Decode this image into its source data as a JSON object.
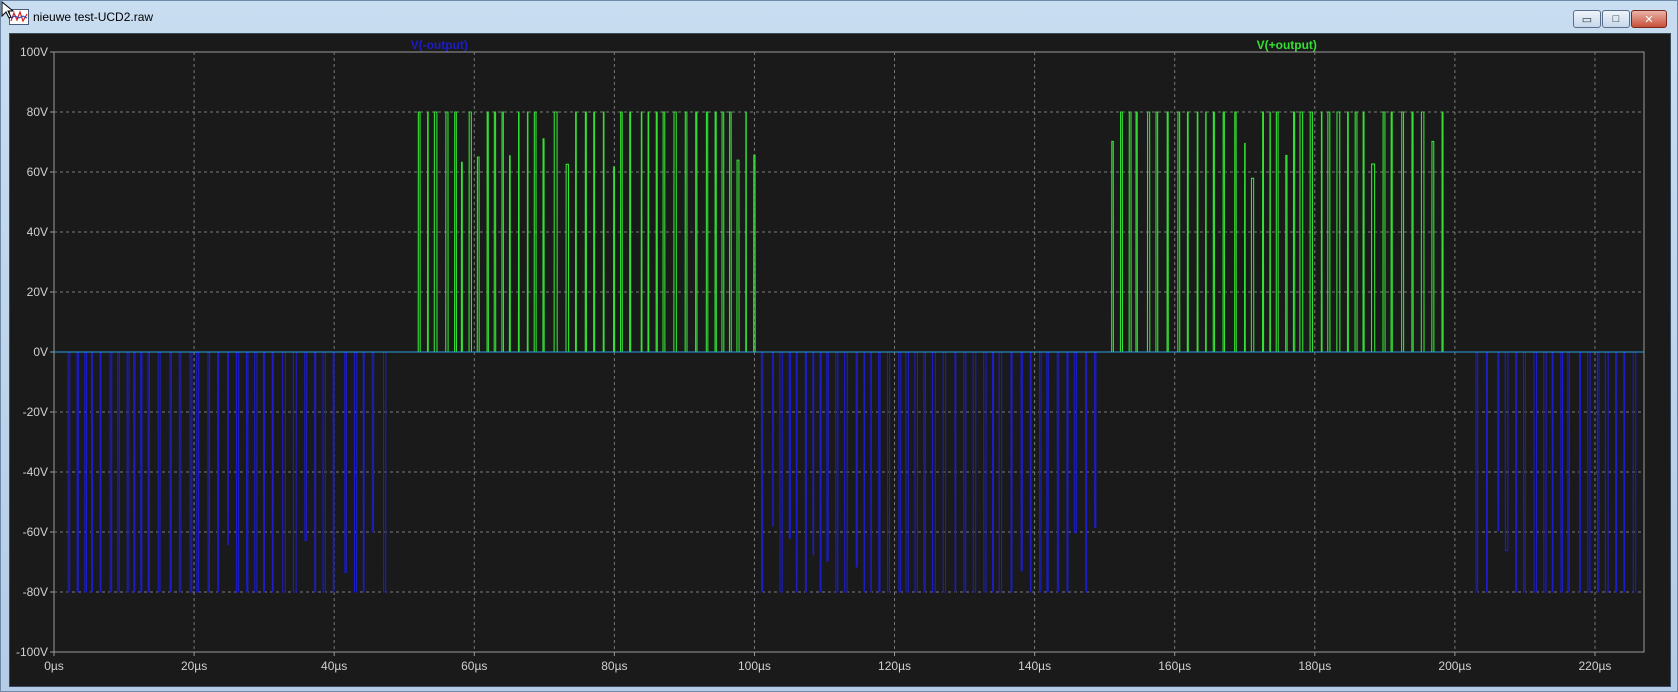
{
  "window": {
    "title": "nieuwe test-UCD2.raw",
    "controls": {
      "minimize": "▭",
      "maximize": "□",
      "close": "✕"
    }
  },
  "chart_data": {
    "type": "line",
    "title": "",
    "xlabel": "",
    "ylabel": "",
    "xlim": [
      0,
      227
    ],
    "ylim": [
      -100,
      100
    ],
    "grid": true,
    "x_unit": "µs",
    "y_unit": "V",
    "x_ticks": [
      "0µs",
      "20µs",
      "40µs",
      "60µs",
      "80µs",
      "100µs",
      "120µs",
      "140µs",
      "160µs",
      "180µs",
      "200µs",
      "220µs"
    ],
    "y_ticks": [
      "100V",
      "80V",
      "60V",
      "40V",
      "20V",
      "0V",
      "-20V",
      "-40V",
      "-60V",
      "-80V",
      "-100V"
    ],
    "series": [
      {
        "name": "V(-output)",
        "color": "#1c1cc8",
        "level": -80,
        "pulse_windows": [
          [
            2,
            48
          ],
          [
            101,
            149
          ],
          [
            203,
            227
          ]
        ]
      },
      {
        "name": "V(+output)",
        "color": "#33e033",
        "level": 80,
        "pulse_windows": [
          [
            52,
            100
          ],
          [
            151,
            199
          ]
        ]
      }
    ]
  },
  "colors": {
    "background": "#1a1a1a",
    "grid": "#7a7a7a",
    "axis_text": "#d0d0d0"
  }
}
